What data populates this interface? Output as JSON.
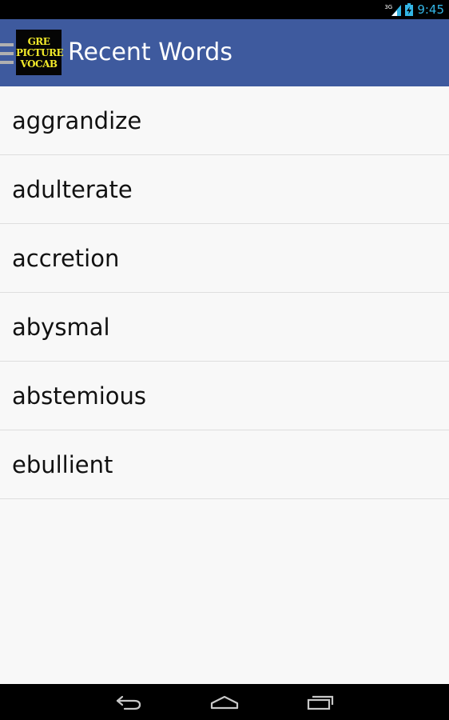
{
  "status_bar": {
    "network": "3G",
    "time": "9:45",
    "icons": [
      "signal-icon",
      "battery-icon"
    ]
  },
  "action_bar": {
    "logo_lines": [
      "GRE",
      "PICTURE",
      "VOCAB"
    ],
    "title": "Recent Words",
    "icons": [
      "drawer-menu-icon"
    ]
  },
  "recent_words": [
    "aggrandize",
    "adulterate",
    "accretion",
    "abysmal",
    "abstemious",
    "ebullient"
  ],
  "nav_bar": {
    "icons": [
      "back-icon",
      "home-icon",
      "recent-apps-icon"
    ]
  },
  "colors": {
    "action_bar": "#3e5a9e",
    "status_bar": "#000000",
    "status_accent": "#33b5e5",
    "background": "#f8f8f8",
    "divider": "#dedede",
    "logo_text": "#f2ea2a"
  }
}
